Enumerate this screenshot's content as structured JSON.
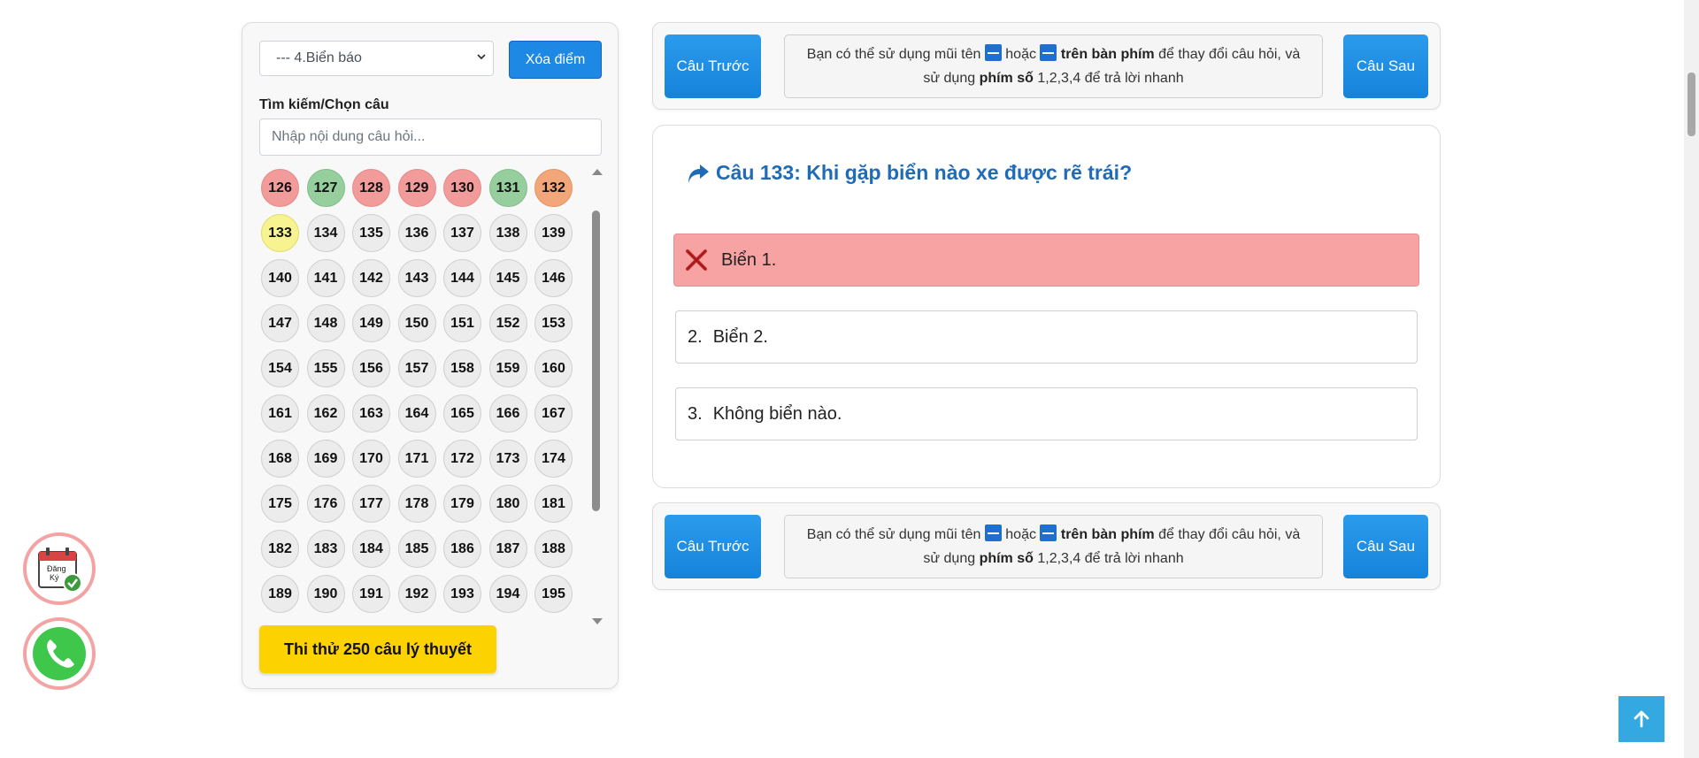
{
  "left_panel": {
    "topic_select": "--- 4.Biển báo",
    "reset_button": "Xóa điểm",
    "search_label": "Tìm kiếm/Chọn câu",
    "search_placeholder": "Nhập nội dung câu hỏi...",
    "questions": [
      {
        "n": "126",
        "s": "wrong"
      },
      {
        "n": "127",
        "s": "right"
      },
      {
        "n": "128",
        "s": "wrong"
      },
      {
        "n": "129",
        "s": "wrong"
      },
      {
        "n": "130",
        "s": "wrong"
      },
      {
        "n": "131",
        "s": "right"
      },
      {
        "n": "132",
        "s": "skipped"
      },
      {
        "n": "133",
        "s": "current"
      },
      {
        "n": "134",
        "s": ""
      },
      {
        "n": "135",
        "s": ""
      },
      {
        "n": "136",
        "s": ""
      },
      {
        "n": "137",
        "s": ""
      },
      {
        "n": "138",
        "s": ""
      },
      {
        "n": "139",
        "s": ""
      },
      {
        "n": "140",
        "s": ""
      },
      {
        "n": "141",
        "s": ""
      },
      {
        "n": "142",
        "s": ""
      },
      {
        "n": "143",
        "s": ""
      },
      {
        "n": "144",
        "s": ""
      },
      {
        "n": "145",
        "s": ""
      },
      {
        "n": "146",
        "s": ""
      },
      {
        "n": "147",
        "s": ""
      },
      {
        "n": "148",
        "s": ""
      },
      {
        "n": "149",
        "s": ""
      },
      {
        "n": "150",
        "s": ""
      },
      {
        "n": "151",
        "s": ""
      },
      {
        "n": "152",
        "s": ""
      },
      {
        "n": "153",
        "s": ""
      },
      {
        "n": "154",
        "s": ""
      },
      {
        "n": "155",
        "s": ""
      },
      {
        "n": "156",
        "s": ""
      },
      {
        "n": "157",
        "s": ""
      },
      {
        "n": "158",
        "s": ""
      },
      {
        "n": "159",
        "s": ""
      },
      {
        "n": "160",
        "s": ""
      },
      {
        "n": "161",
        "s": ""
      },
      {
        "n": "162",
        "s": ""
      },
      {
        "n": "163",
        "s": ""
      },
      {
        "n": "164",
        "s": ""
      },
      {
        "n": "165",
        "s": ""
      },
      {
        "n": "166",
        "s": ""
      },
      {
        "n": "167",
        "s": ""
      },
      {
        "n": "168",
        "s": ""
      },
      {
        "n": "169",
        "s": ""
      },
      {
        "n": "170",
        "s": ""
      },
      {
        "n": "171",
        "s": ""
      },
      {
        "n": "172",
        "s": ""
      },
      {
        "n": "173",
        "s": ""
      },
      {
        "n": "174",
        "s": ""
      },
      {
        "n": "175",
        "s": ""
      },
      {
        "n": "176",
        "s": ""
      },
      {
        "n": "177",
        "s": ""
      },
      {
        "n": "178",
        "s": ""
      },
      {
        "n": "179",
        "s": ""
      },
      {
        "n": "180",
        "s": ""
      },
      {
        "n": "181",
        "s": ""
      },
      {
        "n": "182",
        "s": ""
      },
      {
        "n": "183",
        "s": ""
      },
      {
        "n": "184",
        "s": ""
      },
      {
        "n": "185",
        "s": ""
      },
      {
        "n": "186",
        "s": ""
      },
      {
        "n": "187",
        "s": ""
      },
      {
        "n": "188",
        "s": ""
      },
      {
        "n": "189",
        "s": ""
      },
      {
        "n": "190",
        "s": ""
      },
      {
        "n": "191",
        "s": ""
      },
      {
        "n": "192",
        "s": ""
      },
      {
        "n": "193",
        "s": ""
      },
      {
        "n": "194",
        "s": ""
      },
      {
        "n": "195",
        "s": ""
      }
    ],
    "exam_button": "Thi thử 250 câu lý thuyết"
  },
  "nav": {
    "prev_label": "Câu Trước",
    "next_label": "Câu Sau",
    "hint_part1": "Bạn có thể sử dụng mũi tên ",
    "hint_part2": " hoặc ",
    "hint_bold1": "trên bàn phím",
    "hint_part3": " để thay đổi câu hỏi, và sử dụng ",
    "hint_bold2": "phím số",
    "hint_part4": " 1,2,3,4 để trả lời nhanh"
  },
  "question": {
    "title": "Câu 133: Khi gặp biển nào xe được rẽ trái?",
    "answers": [
      {
        "num": "",
        "text": "Biển 1.",
        "state": "wrong-choice"
      },
      {
        "num": "2.",
        "text": "Biển 2.",
        "state": ""
      },
      {
        "num": "3.",
        "text": "Không biển nào.",
        "state": ""
      }
    ]
  },
  "floating": {
    "register_icon_text1": "Đăng",
    "register_icon_text2": "Ký"
  },
  "colors": {
    "wrong": "#f29b9b",
    "right": "#96cf9d",
    "skipped": "#f2a679",
    "current": "#f7f390",
    "primary": "#1e88e5",
    "title": "#1f6bb5",
    "exam": "#fcd200"
  }
}
